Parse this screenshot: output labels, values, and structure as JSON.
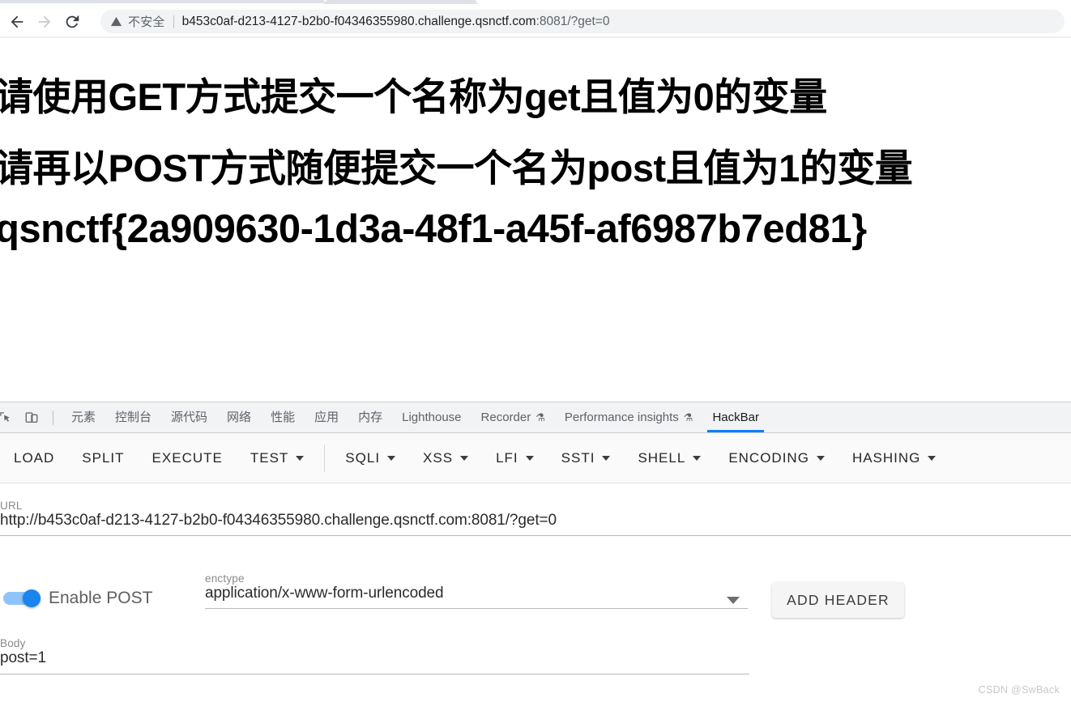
{
  "browser": {
    "back_icon": "back-arrow-icon",
    "forward_icon": "forward-arrow-icon",
    "reload_icon": "reload-icon",
    "security_icon": "not-secure-warning-icon",
    "security_label": "不安全",
    "url_main": "b453c0af-d213-4127-b2b0-f04346355980.challenge.qsnctf.com",
    "url_port_path": ":8081/?get=0"
  },
  "page": {
    "line1": "请使用GET方式提交一个名称为get且值为0的变量",
    "line2": "请再以POST方式随便提交一个名为post且值为1的变量",
    "line3": "qsnctf{2a909630-1d3a-48f1-a45f-af6987b7ed81}"
  },
  "devtools": {
    "inspect_icon": "inspect-element-icon",
    "device_icon": "device-toolbar-icon",
    "tabs": [
      {
        "label": "元素",
        "active": false,
        "beaker": ""
      },
      {
        "label": "控制台",
        "active": false,
        "beaker": ""
      },
      {
        "label": "源代码",
        "active": false,
        "beaker": ""
      },
      {
        "label": "网络",
        "active": false,
        "beaker": ""
      },
      {
        "label": "性能",
        "active": false,
        "beaker": ""
      },
      {
        "label": "应用",
        "active": false,
        "beaker": ""
      },
      {
        "label": "内存",
        "active": false,
        "beaker": ""
      },
      {
        "label": "Lighthouse",
        "active": false,
        "beaker": ""
      },
      {
        "label": "Recorder",
        "active": false,
        "beaker": "⚗"
      },
      {
        "label": "Performance insights",
        "active": false,
        "beaker": "⚗"
      },
      {
        "label": "HackBar",
        "active": true,
        "beaker": ""
      }
    ],
    "active_tab_accent": "#0b7fff"
  },
  "hackbar": {
    "toolbar": [
      {
        "label": "LOAD",
        "caret": false
      },
      {
        "label": "SPLIT",
        "caret": false
      },
      {
        "label": "EXECUTE",
        "caret": false
      },
      {
        "label": "TEST",
        "caret": true
      },
      {
        "label": "SQLI",
        "caret": true
      },
      {
        "label": "XSS",
        "caret": true
      },
      {
        "label": "LFI",
        "caret": true
      },
      {
        "label": "SSTI",
        "caret": true
      },
      {
        "label": "SHELL",
        "caret": true
      },
      {
        "label": "ENCODING",
        "caret": true
      },
      {
        "label": "HASHING",
        "caret": true
      }
    ],
    "url_label": "URL",
    "url_value": "http://b453c0af-d213-4127-b2b0-f04346355980.challenge.qsnctf.com:8081/?get=0",
    "enable_post_label": "Enable POST",
    "enable_post_on": true,
    "enctype_label": "enctype",
    "enctype_value": "application/x-www-form-urlencoded",
    "add_header_label": "ADD HEADER",
    "body_label": "Body",
    "body_value": "post=1",
    "toggle_color": "#1a84ef"
  },
  "watermark": "CSDN @SwBack"
}
